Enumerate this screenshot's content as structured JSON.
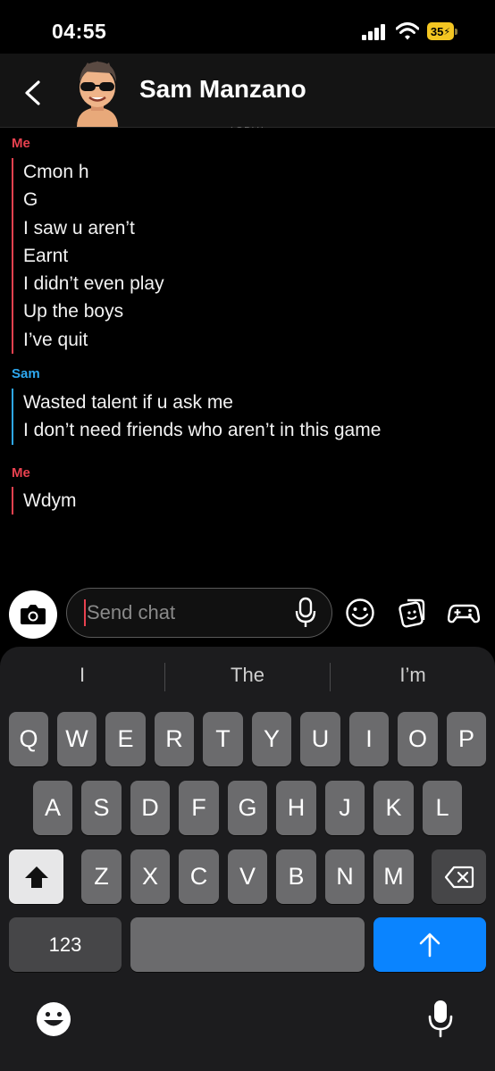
{
  "status": {
    "time": "04:55",
    "battery": "35"
  },
  "header": {
    "name": "Sam Manzano",
    "today": "TODAY"
  },
  "messages": [
    {
      "sender": "Me",
      "lines": [
        "Cmon h",
        "G",
        "I saw u aren’t",
        "Earnt",
        "I didn’t even play",
        "Up the boys",
        "I’ve quit"
      ]
    },
    {
      "sender": "Sam",
      "lines": [
        "Wasted talent if u ask me",
        "I don’t need friends who aren’t in this game"
      ]
    },
    {
      "sender": "Me",
      "lines": [
        "Wdym"
      ]
    }
  ],
  "input": {
    "placeholder": "Send chat"
  },
  "suggestions": [
    "I",
    "The",
    "I’m"
  ],
  "keys": {
    "row1": [
      "Q",
      "W",
      "E",
      "R",
      "T",
      "Y",
      "U",
      "I",
      "O",
      "P"
    ],
    "row2": [
      "A",
      "S",
      "D",
      "F",
      "G",
      "H",
      "J",
      "K",
      "L"
    ],
    "row3": [
      "Z",
      "X",
      "C",
      "V",
      "B",
      "N",
      "M"
    ],
    "numbers": "123"
  },
  "colors": {
    "me": "#e8414f",
    "sam": "#2ea8f0",
    "send_key": "#0a84ff",
    "battery": "#f4c622"
  }
}
